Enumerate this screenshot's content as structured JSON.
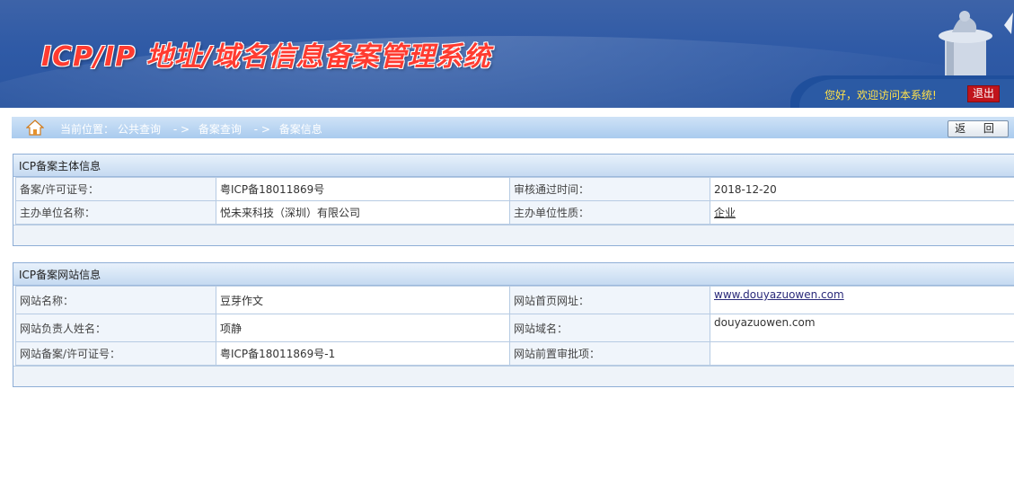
{
  "header": {
    "title": "ICP/IP 地址/域名信息备案管理系统",
    "welcome": "您好，欢迎访问本系统!",
    "logout_label": "退出"
  },
  "breadcrumb": {
    "prefix": "当前位置：",
    "items": [
      "公共查询",
      "- >",
      "备案查询",
      "- >",
      "备案信息"
    ]
  },
  "back_label": "返 回",
  "entity_panel": {
    "title": "ICP备案主体信息",
    "rows": [
      {
        "label1": "备案/许可证号：",
        "value1": "粤ICP备18011869号",
        "label2": "审核通过时间：",
        "value2": "2018-12-20"
      },
      {
        "label1": "主办单位名称：",
        "value1": "悦未来科技（深圳）有限公司",
        "label2": "主办单位性质：",
        "value2": "企业"
      }
    ]
  },
  "site_panel": {
    "title": "ICP备案网站信息",
    "rows": [
      {
        "label1": "网站名称：",
        "value1": "豆芽作文",
        "label2": "网站首页网址：",
        "value2": "www.douyazuowen.com"
      },
      {
        "label1": "网站负责人姓名：",
        "value1": "项静",
        "label2": "网站域名：",
        "value2": "douyazuowen.com"
      },
      {
        "label1": "网站备案/许可证号：",
        "value1": "粤ICP备18011869号-1",
        "label2": "网站前置审批项：",
        "value2": ""
      }
    ]
  },
  "colors": {
    "header_blue": "#2f5aa6",
    "title_red": "#ff3b30",
    "welcome_yellow": "#ffe14a",
    "logout_red": "#c0141b"
  }
}
